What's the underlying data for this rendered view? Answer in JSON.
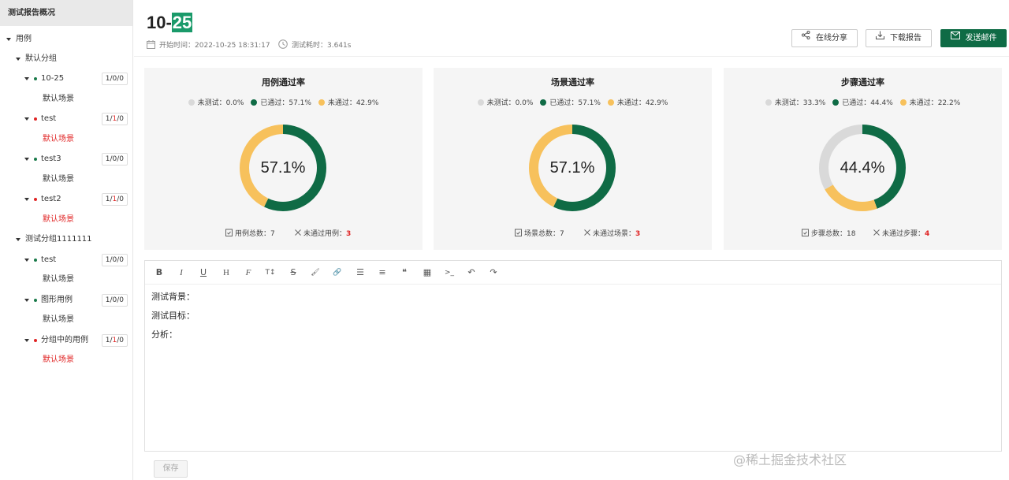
{
  "sidebar": {
    "title": "测试报告概况",
    "tree": [
      {
        "label": "用例"
      },
      {
        "label": "默认分组"
      },
      {
        "label": "10-25",
        "status": "pass",
        "count_a": "1/",
        "count_b": "0",
        "count_c": "/0"
      },
      {
        "label": "默认场景",
        "status": "pass"
      },
      {
        "label": "test",
        "status": "fail",
        "count_a": "1/",
        "count_b": "1",
        "count_c": "/0"
      },
      {
        "label": "默认场景",
        "status": "fail"
      },
      {
        "label": "test3",
        "status": "pass",
        "count_a": "1/",
        "count_b": "0",
        "count_c": "/0"
      },
      {
        "label": "默认场景",
        "status": "pass"
      },
      {
        "label": "test2",
        "status": "fail",
        "count_a": "1/",
        "count_b": "1",
        "count_c": "/0"
      },
      {
        "label": "默认场景",
        "status": "fail"
      },
      {
        "label": "测试分组1111111"
      },
      {
        "label": "test",
        "status": "pass",
        "count_a": "1/",
        "count_b": "0",
        "count_c": "/0"
      },
      {
        "label": "默认场景",
        "status": "pass"
      },
      {
        "label": "图形用例",
        "status": "pass",
        "count_a": "1/",
        "count_b": "0",
        "count_c": "/0"
      },
      {
        "label": "默认场景",
        "status": "pass"
      },
      {
        "label": "分组中的用例",
        "status": "fail",
        "count_a": "1/",
        "count_b": "1",
        "count_c": "/0"
      },
      {
        "label": "默认场景",
        "status": "fail"
      }
    ]
  },
  "header": {
    "title_prefix": "10-",
    "title_highlight": "25",
    "start_label": "开始时间：",
    "start_value": "2022-10-25 18:31:17",
    "duration_label": "测试耗时：",
    "duration_value": "3.641s",
    "share_button": "在线分享",
    "download_button": "下载报告",
    "email_button": "发送邮件"
  },
  "cards": [
    {
      "title": "用例通过率",
      "legend": [
        {
          "name": "未测试：",
          "value": "0.0%"
        },
        {
          "name": "已通过：",
          "value": "57.1%"
        },
        {
          "name": "未通过：",
          "value": "42.9%"
        }
      ],
      "untested": 0.0,
      "passed": 0.571,
      "failed": 0.429,
      "center": "57.1%",
      "total_label": "用例总数：",
      "total_value": "7",
      "failed_label": "未通过用例：",
      "failed_value": "3"
    },
    {
      "title": "场景通过率",
      "legend": [
        {
          "name": "未测试：",
          "value": "0.0%"
        },
        {
          "name": "已通过：",
          "value": "57.1%"
        },
        {
          "name": "未通过：",
          "value": "42.9%"
        }
      ],
      "untested": 0.0,
      "passed": 0.571,
      "failed": 0.429,
      "center": "57.1%",
      "total_label": "场景总数：",
      "total_value": "7",
      "failed_label": "未通过场景：",
      "failed_value": "3"
    },
    {
      "title": "步骤通过率",
      "legend": [
        {
          "name": "未测试：",
          "value": "33.3%"
        },
        {
          "name": "已通过：",
          "value": "44.4%"
        },
        {
          "name": "未通过：",
          "value": "22.2%"
        }
      ],
      "untested": 0.333,
      "passed": 0.444,
      "failed": 0.222,
      "center": "44.4%",
      "total_label": "步骤总数：",
      "total_value": "18",
      "failed_label": "未通过步骤：",
      "failed_value": "4"
    }
  ],
  "colors": {
    "untested": "#d9d9d9",
    "passed": "#0f6b45",
    "failed": "#f7c15c"
  },
  "editor": {
    "toolbar": [
      "B",
      "I",
      "U",
      "H",
      "F",
      "T↕",
      "S",
      "🖌",
      "🔗",
      "☰",
      "≡",
      "❝",
      "▦",
      ">_",
      "↶",
      "↷"
    ],
    "lines": [
      "测试背景：",
      "测试目标：",
      "分析："
    ],
    "save_button": "保存"
  },
  "watermark": "@稀土掘金技术社区"
}
